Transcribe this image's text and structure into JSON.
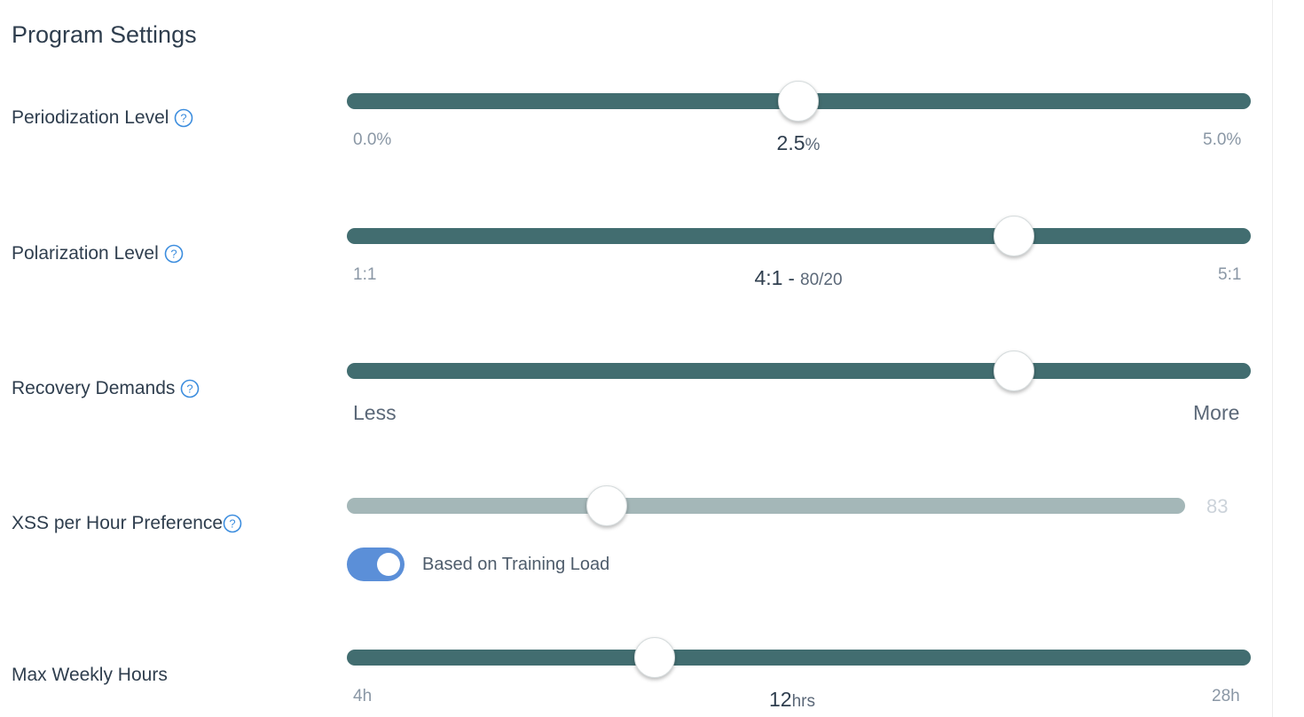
{
  "page": {
    "title": "Program Settings"
  },
  "help_icon": "question-circle-icon",
  "colors": {
    "track_active": "#426d70",
    "track_disabled": "#a4b7b8",
    "toggle_on": "#5b8fd8"
  },
  "settings": {
    "periodization": {
      "label": "Periodization Level",
      "min_label": "0.0%",
      "max_label": "5.0%",
      "value": "2.5",
      "unit": "%",
      "position_fraction": 0.5
    },
    "polarization": {
      "label": "Polarization Level",
      "min_label": "1:1",
      "max_label": "5:1",
      "value": "4:1",
      "separator": " - ",
      "detail": "80/20",
      "position_fraction": 0.74
    },
    "recovery": {
      "label": "Recovery Demands",
      "min_label": "Less",
      "max_label": "More",
      "position_fraction": 0.74
    },
    "xss": {
      "label": "XSS per Hour Preference",
      "value": "83",
      "disabled": true,
      "position_fraction": 0.31,
      "toggle": {
        "label": "Based on Training Load",
        "on": true
      }
    },
    "max_weekly_hours": {
      "label": "Max Weekly Hours",
      "min_label": "4h",
      "max_label": "28h",
      "value": "12",
      "unit": "hrs",
      "position_fraction": 0.34
    }
  }
}
